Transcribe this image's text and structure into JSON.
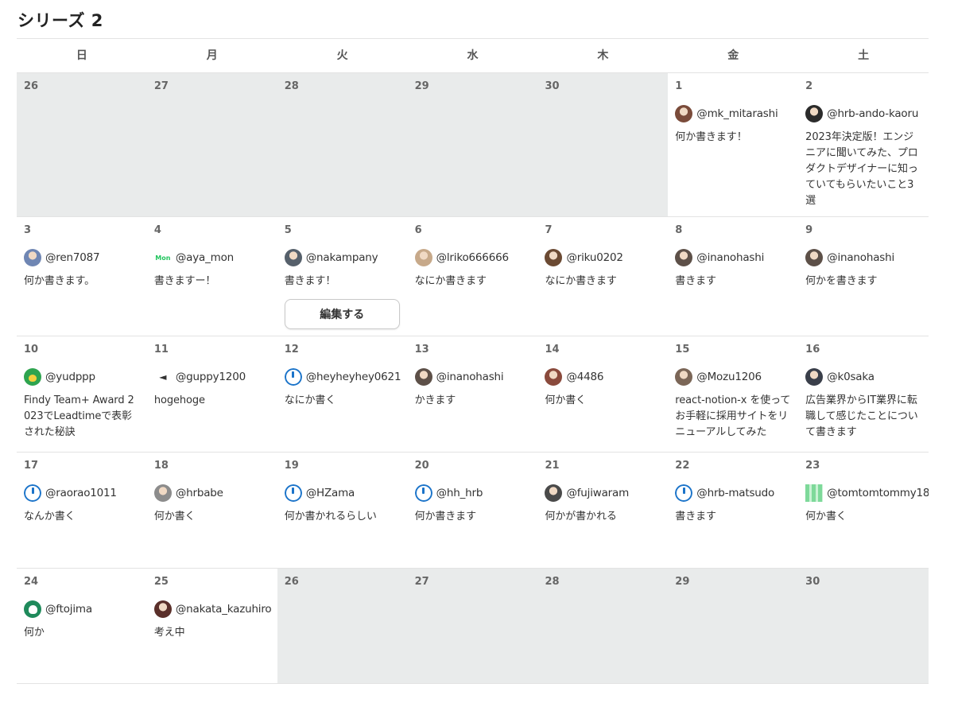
{
  "page": {
    "title": "シリーズ 2"
  },
  "calendar": {
    "weekday_headers": [
      "日",
      "月",
      "火",
      "水",
      "木",
      "金",
      "土"
    ],
    "edit_button_label": "編集する",
    "weeks": [
      [
        {
          "date": "26",
          "empty": true
        },
        {
          "date": "27",
          "empty": true
        },
        {
          "date": "28",
          "empty": true
        },
        {
          "date": "29",
          "empty": true
        },
        {
          "date": "30",
          "empty": true
        },
        {
          "date": "1",
          "handle": "@mk_mitarashi",
          "title": "何か書きます！",
          "avatar": "portrait-avatar",
          "avatar_color": "#7a4b3a"
        },
        {
          "date": "2",
          "handle": "@hrb-ando-kaoru",
          "title": "2023年決定版！エンジニアに聞いてみた、プロダクトデザイナーに知っていてもらいたいこと3選",
          "avatar": "portrait-avatar",
          "avatar_color": "#2b2b2b"
        }
      ],
      [
        {
          "date": "3",
          "handle": "@ren7087",
          "title": "何か書きます。",
          "avatar": "portrait-avatar",
          "avatar_color": "#6f86b3"
        },
        {
          "date": "4",
          "handle": "@aya_mon",
          "title": "書きますー！",
          "avatar": "logo-text-avatar",
          "avatar_color": "#22c55e",
          "avatar_text": "Mon"
        },
        {
          "date": "5",
          "handle": "@nakampany",
          "title": "書きます！",
          "avatar": "portrait-avatar",
          "avatar_color": "#56606b",
          "editable": true
        },
        {
          "date": "6",
          "handle": "@lriko666666",
          "title": "なにか書きます",
          "avatar": "animal-avatar",
          "avatar_color": "#c7a98a"
        },
        {
          "date": "7",
          "handle": "@riku0202",
          "title": "なにか書きます",
          "avatar": "portrait-avatar",
          "avatar_color": "#6b4a33"
        },
        {
          "date": "8",
          "handle": "@inanohashi",
          "title": "書きます",
          "avatar": "portrait-avatar",
          "avatar_color": "#5d5048"
        },
        {
          "date": "9",
          "handle": "@inanohashi",
          "title": "何かを書きます",
          "avatar": "portrait-avatar",
          "avatar_color": "#5d5048"
        }
      ],
      [
        {
          "date": "10",
          "handle": "@yudppp",
          "title": "Findy Team+ Award 2023でLeadtimeで表彰された秘訣",
          "avatar": "duck-avatar",
          "avatar_color": "#2ea44f"
        },
        {
          "date": "11",
          "handle": "@guppy1200",
          "title": "hogehoge",
          "avatar": "fish-icon",
          "avatar_color": "#ffffff"
        },
        {
          "date": "12",
          "handle": "@heyheyhey0621",
          "title": "なにか書く",
          "avatar": "power-icon",
          "avatar_color": "#1a73c9"
        },
        {
          "date": "13",
          "handle": "@inanohashi",
          "title": "かきます",
          "avatar": "portrait-avatar",
          "avatar_color": "#5d5048"
        },
        {
          "date": "14",
          "handle": "@4486",
          "title": "何か書く",
          "avatar": "portrait-avatar",
          "avatar_color": "#8a4a3c"
        },
        {
          "date": "15",
          "handle": "@Mozu1206",
          "title": "react-notion-x を使ってお手軽に採用サイトをリニューアルしてみた",
          "avatar": "portrait-avatar",
          "avatar_color": "#7b6657"
        },
        {
          "date": "16",
          "handle": "@k0saka",
          "title": "広告業界からIT業界に転職して感じたことについて書きます",
          "avatar": "portrait-avatar",
          "avatar_color": "#3a3f4a"
        }
      ],
      [
        {
          "date": "17",
          "handle": "@raorao1011",
          "title": "なんか書く",
          "avatar": "power-icon",
          "avatar_color": "#1a73c9"
        },
        {
          "date": "18",
          "handle": "@hrbabe",
          "title": "何か書く",
          "avatar": "portrait-avatar",
          "avatar_color": "#8c8c8c"
        },
        {
          "date": "19",
          "handle": "@HZama",
          "title": "何か書かれるらしい",
          "avatar": "power-icon",
          "avatar_color": "#1a73c9"
        },
        {
          "date": "20",
          "handle": "@hh_hrb",
          "title": "何か書きます",
          "avatar": "power-icon",
          "avatar_color": "#1a73c9"
        },
        {
          "date": "21",
          "handle": "@fujiwaram",
          "title": "何かが書かれる",
          "avatar": "portrait-avatar",
          "avatar_color": "#4a4a4a"
        },
        {
          "date": "22",
          "handle": "@hrb-matsudo",
          "title": "書きます",
          "avatar": "power-icon",
          "avatar_color": "#1a73c9"
        },
        {
          "date": "23",
          "handle": "@tomtomtommy18",
          "title": "何か書く",
          "avatar": "pixel-avatar",
          "avatar_color": "#7ed99a"
        }
      ],
      [
        {
          "date": "24",
          "handle": "@ftojima",
          "title": "何か",
          "avatar": "skull-icon",
          "avatar_color": "#1f8a5b"
        },
        {
          "date": "25",
          "handle": "@nakata_kazuhiro",
          "title": "考え中",
          "avatar": "portrait-avatar",
          "avatar_color": "#5a2f2a"
        },
        {
          "date": "26",
          "empty": true
        },
        {
          "date": "27",
          "empty": true
        },
        {
          "date": "28",
          "empty": true
        },
        {
          "date": "29",
          "empty": true
        },
        {
          "date": "30",
          "empty": true
        }
      ]
    ]
  }
}
